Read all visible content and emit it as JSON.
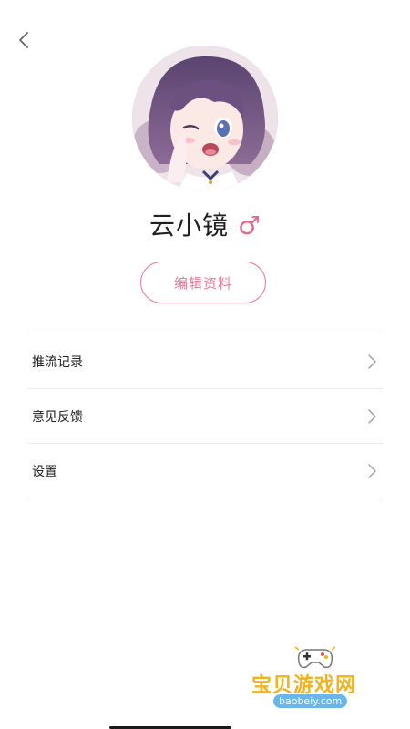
{
  "header": {
    "back_icon": "chevron-left-icon"
  },
  "profile": {
    "name": "云小镜",
    "gender_symbol": "♂",
    "gender_color": "#e36a8b",
    "edit_button_label": "编辑资料",
    "accent_color": "#e57d96"
  },
  "menu": {
    "items": [
      {
        "label": "推流记录",
        "icon": "chevron-right-icon"
      },
      {
        "label": "意见反馈",
        "icon": "chevron-right-icon"
      },
      {
        "label": "设置",
        "icon": "chevron-right-icon"
      }
    ]
  },
  "watermark": {
    "title": "宝贝游戏网",
    "url": "baobeiy.com"
  }
}
